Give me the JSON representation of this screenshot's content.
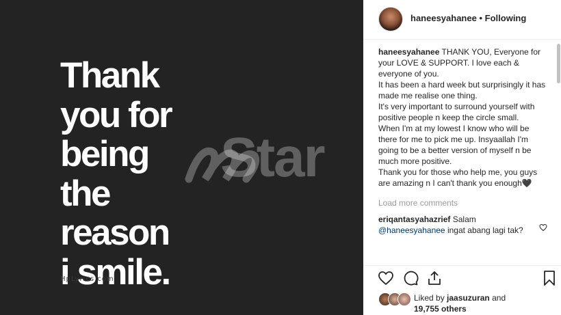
{
  "post_image": {
    "big_text": "Thank\nyou for\nbeing\nthe\nreason\ni smile.",
    "credit": "HpLyrics.com",
    "watermark": "Star"
  },
  "header": {
    "username": "haneesyahanee",
    "separator": "•",
    "follow_status": "Following"
  },
  "caption": {
    "username": "haneesyahanee",
    "text": "THANK YOU, Everyone for your LOVE & SUPPORT. I love each & everyone of you.\nIt has been a hard week but surprisingly it has made me realise one thing.\nIt's very important to surround yourself with positive people n keep the circle small.\nWhen I'm at my lowest I know who will be there for me to pick me up. Insyaallah I'm going to be a better version of myself n be much more positive.\nThank you for those who help me, you guys are amazing n I can't thank you enough🖤"
  },
  "load_more": "Load more comments",
  "reply": {
    "username": "eriqantasyahazrief",
    "text_start": "Salam",
    "mention": "@haneesyahanee",
    "text_end": "ingat abang lagi tak?"
  },
  "actions": {
    "like": "heart-icon",
    "comment": "comment-icon",
    "share": "share-icon",
    "save": "bookmark-icon"
  },
  "likes": {
    "prefix": "Liked by",
    "user": "jaasuzuran",
    "joiner": "and",
    "others": "19,755 others"
  },
  "colors": {
    "image_background": "#232323",
    "mention": "#003569",
    "muted": "#999999",
    "text": "#262626"
  }
}
